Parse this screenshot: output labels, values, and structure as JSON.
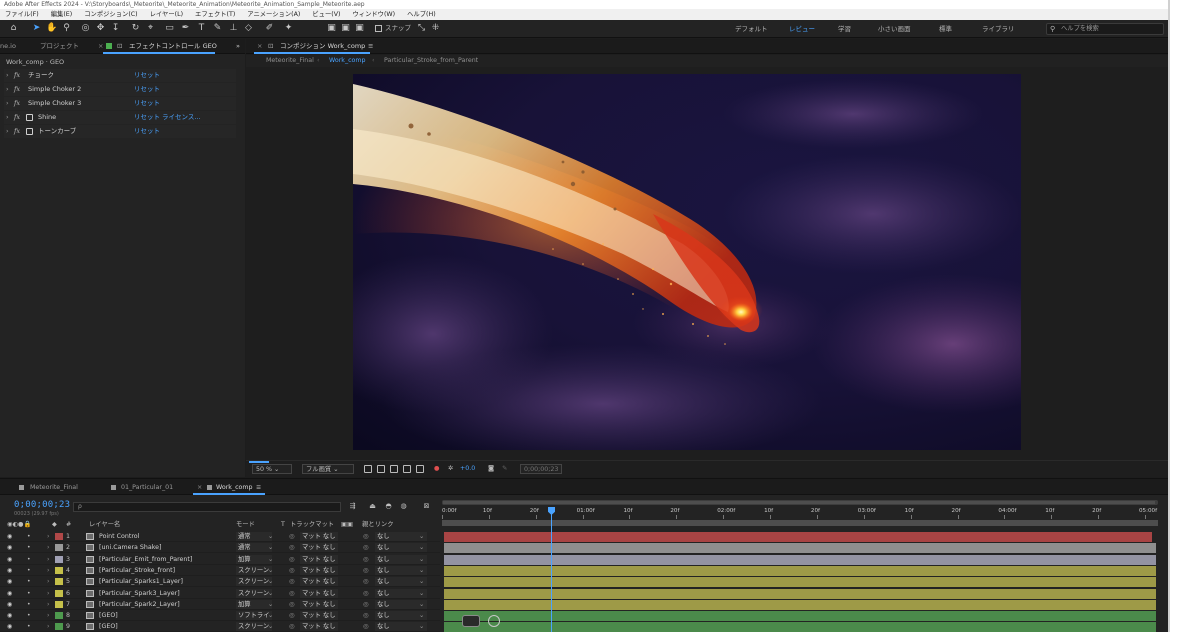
{
  "title_bar": "Adobe After Effects 2024 - V:\\Storyboards\\_Meteorite\\_Meteorite_Animation\\Meteorite_Animation_Sample_Meteorite.aep",
  "menu": [
    "ファイル(F)",
    "編集(E)",
    "コンポジション(C)",
    "レイヤー(L)",
    "エフェクト(T)",
    "アニメーション(A)",
    "ビュー(V)",
    "ウィンドウ(W)",
    "ヘルプ(H)"
  ],
  "toolbar": {
    "snap_label": "スナップ",
    "workspaces": [
      "デフォルト",
      "レビュー",
      "学習",
      "小さい画面",
      "標準",
      "ライブラリ"
    ],
    "active_workspace": "レビュー",
    "help_placeholder": "ヘルプを検索"
  },
  "left_panel": {
    "tabs": [
      "ne.io",
      "プロジェクト",
      "エフェクトコントロール GEO"
    ],
    "subtitle": "Work_comp · GEO",
    "effects": [
      {
        "name": "チョーク",
        "reset": "リセット"
      },
      {
        "name": "Simple Choker 2",
        "reset": "リセット"
      },
      {
        "name": "Simple Choker 3",
        "reset": "リセット"
      },
      {
        "name": "Shine",
        "reset": "リセット",
        "license": "ライセンス..."
      },
      {
        "name": "トーンカーブ",
        "reset": "リセット"
      }
    ]
  },
  "comp_panel": {
    "tab": "コンポジション Work_comp",
    "flow": [
      "Meteorite_Final",
      "Work_comp",
      "Particular_Stroke_from_Parent"
    ],
    "active_flow": "Work_comp",
    "zoom": "50 %",
    "resolution": "フル画質",
    "exposure": "+0.0",
    "timecode": "0;00;00;23"
  },
  "timeline": {
    "tabs": [
      "Meteorite_Final",
      "01_Particular_01",
      "Work_comp"
    ],
    "timecode": "0;00;00;23",
    "fps": "00023 (29.97 fps)",
    "search_placeholder": "ρ",
    "columns": {
      "layer_name": "レイヤー名",
      "mode": "モード",
      "t": "T",
      "trackmatte": "トラックマット",
      "parent": "親とリンク"
    },
    "ruler_ticks": [
      "0:00f",
      "10f",
      "20f",
      "01:00f",
      "10f",
      "20f",
      "02:00f",
      "10f",
      "20f",
      "03:00f",
      "10f",
      "20f",
      "04:00f",
      "10f",
      "20f",
      "05:00f"
    ],
    "layers": [
      {
        "num": "1",
        "name": "Point Control",
        "mode": "通常",
        "matte": "マット なし",
        "parent": "なし",
        "color": "#b04848",
        "bar": "#a84444"
      },
      {
        "num": "2",
        "name": "[uni.Camera Shake]",
        "mode": "通常",
        "matte": "マット なし",
        "parent": "なし",
        "color": "#9a9a9a",
        "bar": "#8f8f8f"
      },
      {
        "num": "3",
        "name": "[Particular_Emit_from_Parent]",
        "mode": "加算",
        "matte": "マット なし",
        "parent": "なし",
        "color": "#a0a0b4",
        "bar": "#9393a2"
      },
      {
        "num": "4",
        "name": "[Particular_Stroke_front]",
        "mode": "スクリーン",
        "matte": "マット なし",
        "parent": "なし",
        "color": "#c5c04a",
        "bar": "#9e9a47"
      },
      {
        "num": "5",
        "name": "[Particular_Sparks1_Layer]",
        "mode": "スクリーン",
        "matte": "マット なし",
        "parent": "なし",
        "color": "#c5c04a",
        "bar": "#9e9a47"
      },
      {
        "num": "6",
        "name": "[Particular_Spark3_Layer]",
        "mode": "スクリーン",
        "matte": "マット なし",
        "parent": "なし",
        "color": "#c5c04a",
        "bar": "#9e9a47"
      },
      {
        "num": "7",
        "name": "[Particular_Spark2_Layer]",
        "mode": "加算",
        "matte": "マット なし",
        "parent": "なし",
        "color": "#c5c04a",
        "bar": "#9e9a47"
      },
      {
        "num": "8",
        "name": "[GEO]",
        "mode": "ソフトライ",
        "matte": "マット なし",
        "parent": "なし",
        "color": "#4e9a4e",
        "bar": "#4b8a4b"
      },
      {
        "num": "9",
        "name": "[GEO]",
        "mode": "スクリーン",
        "matte": "マット なし",
        "parent": "なし",
        "color": "#4e9a4e",
        "bar": "#4b8a4b"
      }
    ]
  }
}
